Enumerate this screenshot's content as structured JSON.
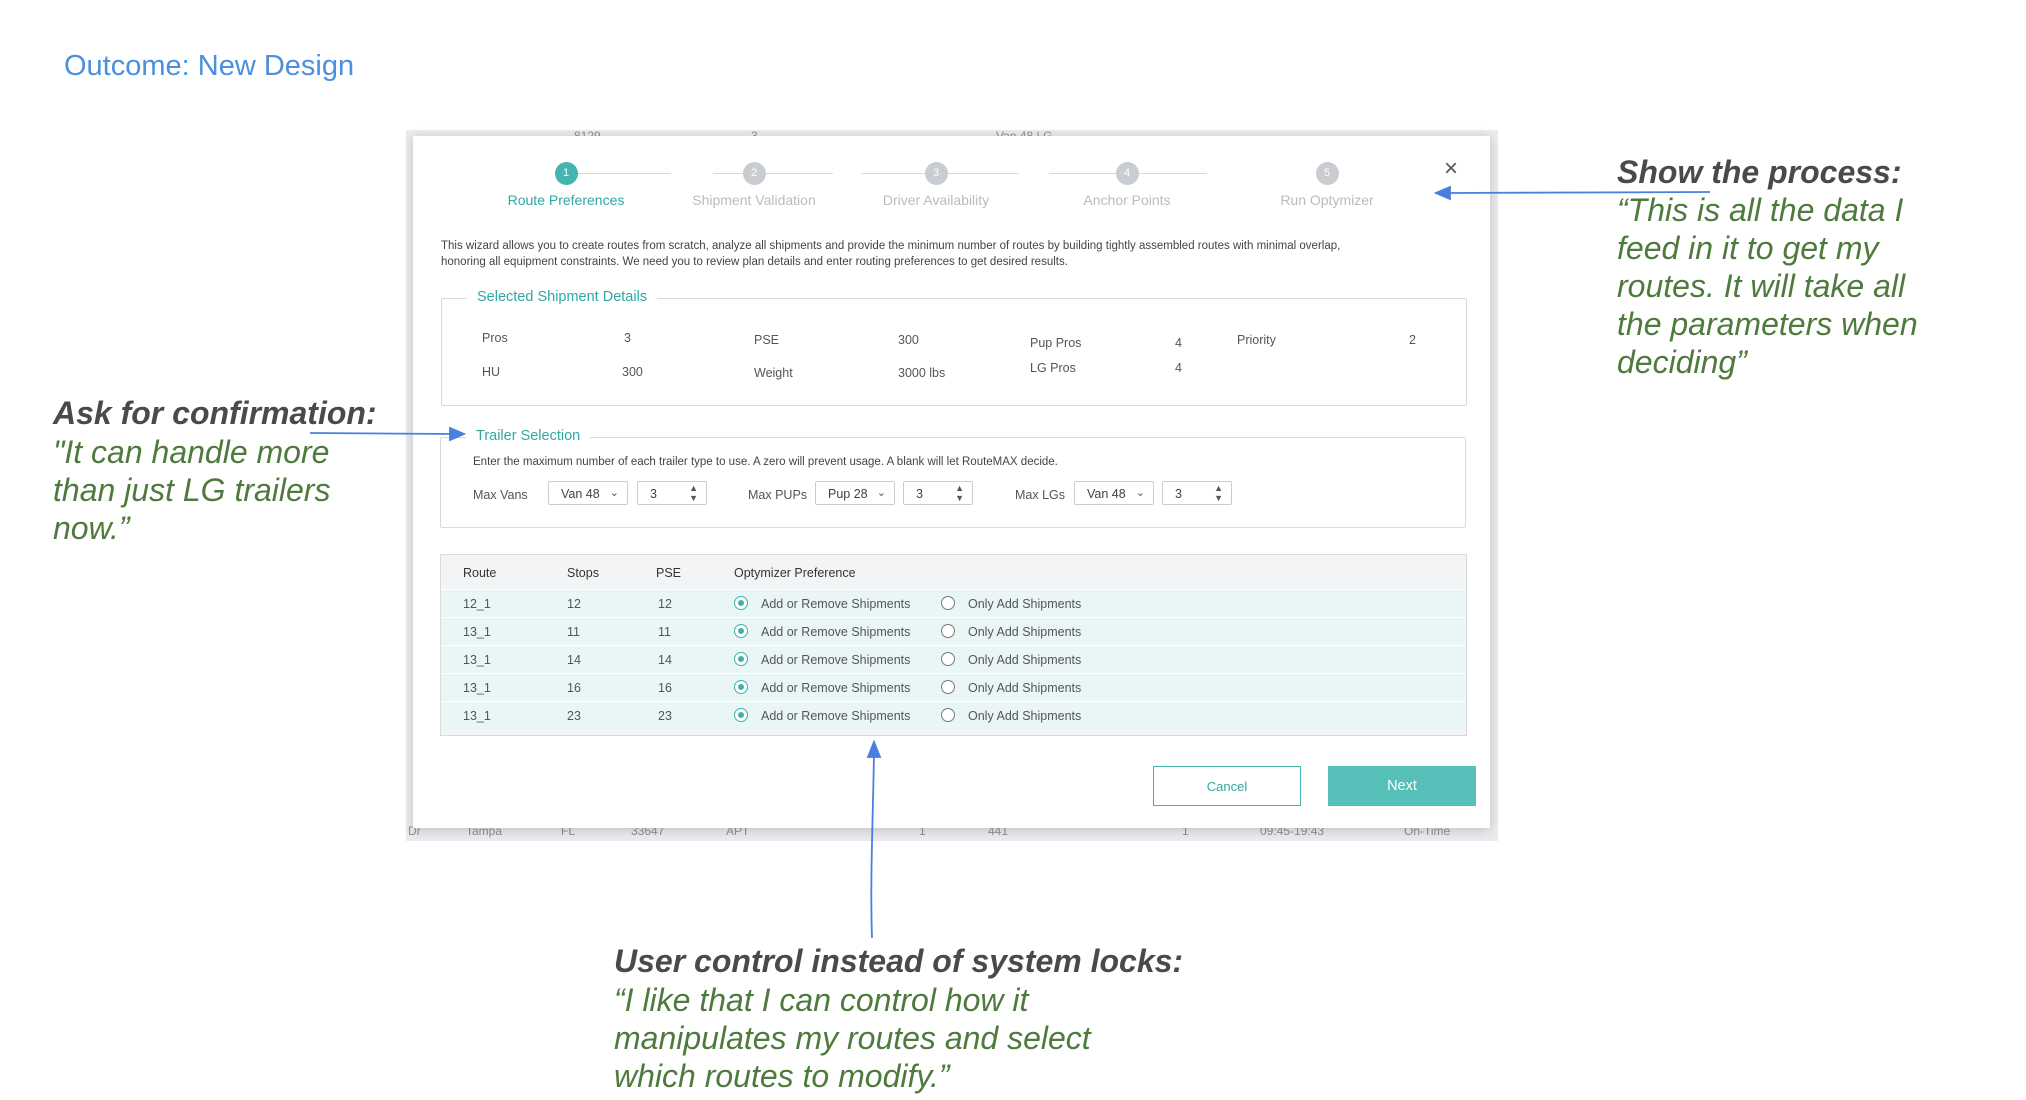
{
  "slide": {
    "title": "Outcome: New Design"
  },
  "background": {
    "top_row": [
      "8129",
      "3",
      "Van 48 LG"
    ],
    "bottom_row": [
      "Dr",
      "Tampa",
      "FL",
      "33647",
      "APT",
      "1",
      "441",
      "1",
      "09:45-19:43",
      "On-Time"
    ]
  },
  "wizard": {
    "close_icon": "×",
    "steps": [
      {
        "num": "1",
        "label": "Route Preferences",
        "active": true
      },
      {
        "num": "2",
        "label": "Shipment Validation",
        "active": false
      },
      {
        "num": "3",
        "label": "Driver Availability",
        "active": false
      },
      {
        "num": "4",
        "label": "Anchor Points",
        "active": false
      },
      {
        "num": "5",
        "label": "Run Optymizer",
        "active": false
      }
    ],
    "intro_line1": "This wizard allows you to create routes from scratch, analyze all shipments and provide the minimum number of routes by building tightly assembled routes with minimal overlap,",
    "intro_line2": "honoring all equipment constraints. We need you to review plan details and enter routing preferences to get desired results.",
    "shipment": {
      "legend": "Selected Shipment Details",
      "pros_label": "Pros",
      "pros_value": "3",
      "hu_label": "HU",
      "hu_value": "300",
      "pse_label": "PSE",
      "pse_value": "300",
      "weight_label": "Weight",
      "weight_value": "3000 lbs",
      "pup_pros_label": "Pup Pros",
      "pup_pros_value": "4",
      "lg_pros_label": "LG Pros",
      "lg_pros_value": "4",
      "priority_label": "Priority",
      "priority_value": "2"
    },
    "trailer": {
      "legend": "Trailer Selection",
      "hint": "Enter the maximum number of each trailer type to use. A zero will prevent usage. A blank will let RouteMAX decide.",
      "vans_label": "Max Vans",
      "vans_type": "Van 48",
      "vans_count": "3",
      "pups_label": "Max PUPs",
      "pups_type": "Pup 28",
      "pups_count": "3",
      "lgs_label": "Max  LGs",
      "lgs_type": "Van 48",
      "lgs_count": "3",
      "chevron_icon": "⌄",
      "updown_icon": "⌃⌄"
    },
    "table": {
      "headers": {
        "route": "Route",
        "stops": "Stops",
        "pse": "PSE",
        "pref": "Optymizer Preference"
      },
      "rows": [
        {
          "route": "12_1",
          "stops": "12",
          "pse": "12",
          "opt1": "Add or Remove Shipments",
          "opt2": "Only Add Shipments",
          "selected": "opt1"
        },
        {
          "route": "13_1",
          "stops": "11",
          "pse": "11",
          "opt1": "Add or Remove Shipments",
          "opt2": "Only Add Shipments",
          "selected": "opt1"
        },
        {
          "route": "13_1",
          "stops": "14",
          "pse": "14",
          "opt1": "Add or Remove Shipments",
          "opt2": "Only Add Shipments",
          "selected": "opt1"
        },
        {
          "route": "13_1",
          "stops": "16",
          "pse": "16",
          "opt1": "Add or Remove Shipments",
          "opt2": "Only Add Shipments",
          "selected": "opt1"
        },
        {
          "route": "13_1",
          "stops": "23",
          "pse": "23",
          "opt1": "Add or Remove Shipments",
          "opt2": "Only Add Shipments",
          "selected": "opt1"
        }
      ]
    },
    "buttons": {
      "cancel": "Cancel",
      "next": "Next"
    }
  },
  "annotations": {
    "process": {
      "heading": "Show the process:",
      "quote": [
        "“This is all the data I",
        "feed in it to get my",
        "routes. It will take all",
        "the parameters when",
        "deciding”"
      ]
    },
    "confirmation": {
      "heading": "Ask for confirmation:",
      "quote": [
        "\"It can handle more",
        "than just LG trailers",
        "now.”"
      ]
    },
    "control": {
      "heading": "User control instead of system locks:",
      "quote": [
        "“I like that I can control how it",
        "manipulates my routes and select",
        "which routes to modify.”"
      ]
    }
  },
  "colors": {
    "accent": "#44b5b0",
    "title_blue": "#4a8fe0",
    "quote_green": "#4e7a3d",
    "arrow_blue": "#4a7fe0"
  }
}
